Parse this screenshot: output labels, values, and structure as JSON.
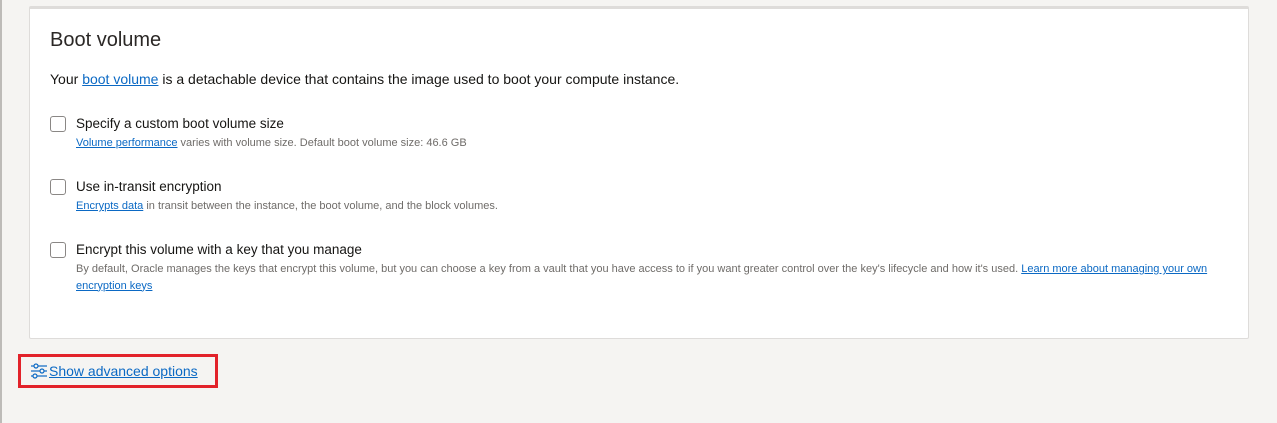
{
  "boot_volume": {
    "title": "Boot volume",
    "intro_prefix": "Your ",
    "intro_link": "boot volume",
    "intro_suffix": " is a detachable device that contains the image used to boot your compute instance.",
    "options": [
      {
        "label": "Specify a custom boot volume size",
        "help_link": "Volume performance",
        "help_text": " varies with volume size. Default boot volume size: 46.6 GB",
        "checked": false
      },
      {
        "label": "Use in-transit encryption",
        "help_link": "Encrypts data",
        "help_text": " in transit between the instance, the boot volume, and the block volumes.",
        "checked": false
      },
      {
        "label": "Encrypt this volume with a key that you manage",
        "help_text": "By default, Oracle manages the keys that encrypt this volume, but you can choose a key from a vault that you have access to if you want greater control over the key's lifecycle and how it's used. ",
        "help_link": "Learn more about managing your own encryption keys",
        "checked": false
      }
    ]
  },
  "advanced": {
    "label": "Show advanced options",
    "icon": "sliders-icon"
  },
  "colors": {
    "link": "#0b69c4",
    "highlight": "#e2222a"
  }
}
